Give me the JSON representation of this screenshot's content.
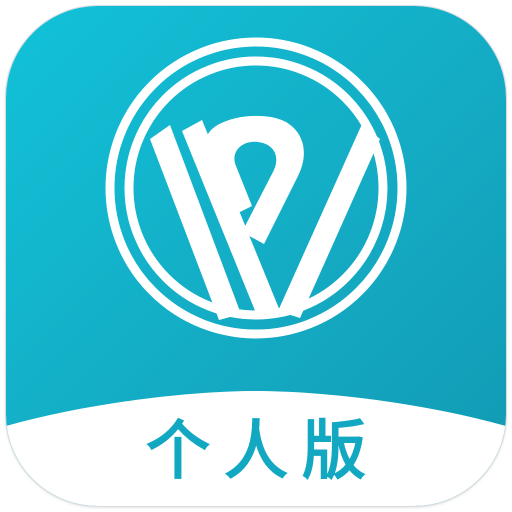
{
  "app_icon": {
    "logo_icon": "w-p-monogram-in-circle",
    "edition_label": "个人版",
    "colors": {
      "gradient_start": "#11c2d8",
      "gradient_end": "#1199b3",
      "logo": "#ffffff",
      "band": "#ffffff",
      "label": "#13a8c2"
    }
  }
}
